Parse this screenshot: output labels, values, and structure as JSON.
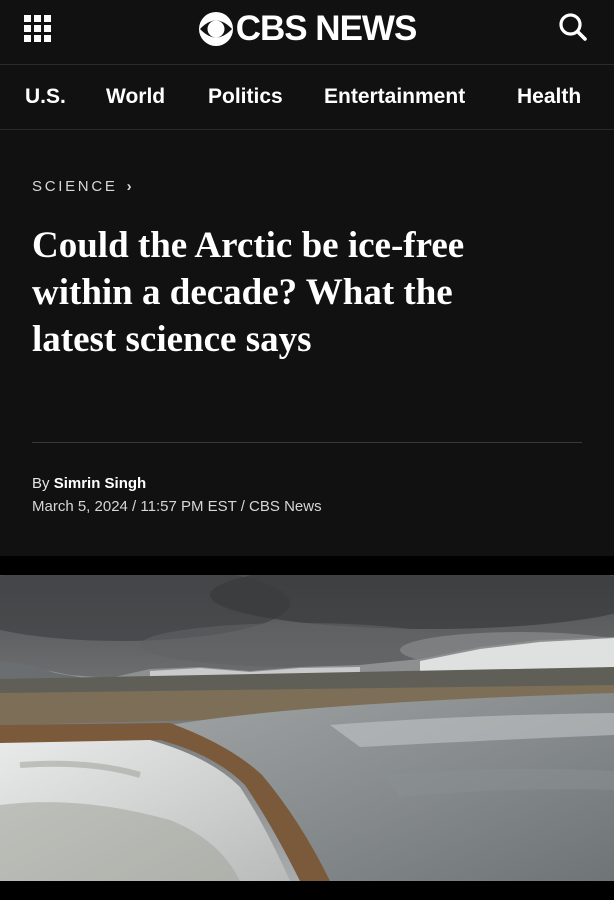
{
  "header": {
    "brand": "CBS NEWS",
    "menu_icon": "grid-menu-icon",
    "search_icon": "search-icon"
  },
  "nav": {
    "items": [
      "U.S.",
      "World",
      "Politics",
      "Entertainment",
      "Health"
    ]
  },
  "article": {
    "section": "SCIENCE",
    "section_icon": "chevron-right-icon",
    "headline": "Could the Arctic be ice-free within a decade? What the latest science says",
    "byline_prefix": "By ",
    "author": "Simrin Singh",
    "dateline": "March 5, 2024 / 11:57 PM EST / CBS News"
  },
  "colors": {
    "page_bg": "#111111",
    "text": "#ffffff",
    "muted_text": "#d8d8d8",
    "divider": "#3a3a3a"
  }
}
